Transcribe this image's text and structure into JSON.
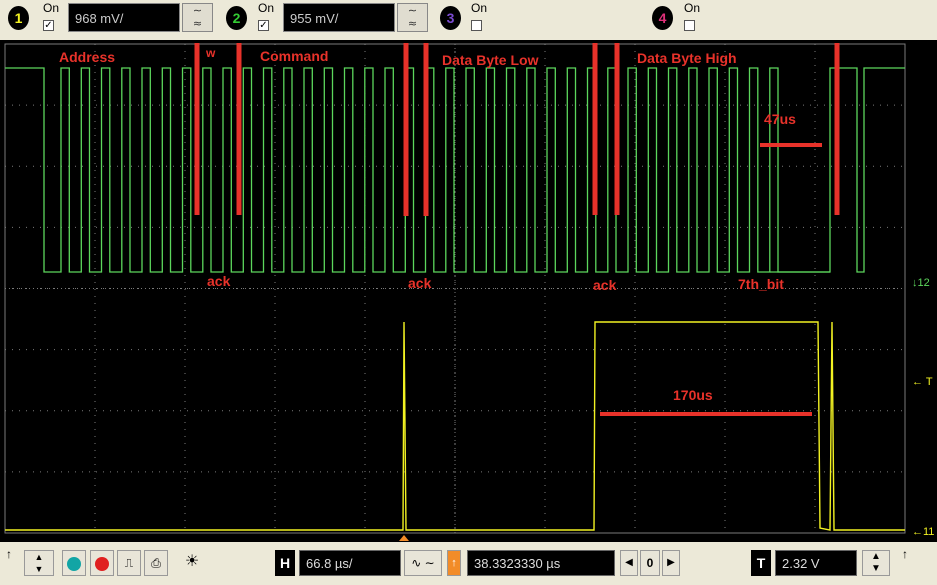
{
  "channels": [
    {
      "num": "1",
      "on_label": "On",
      "checked": true,
      "scale": "968 mV/",
      "color": "#f2f222"
    },
    {
      "num": "2",
      "on_label": "On",
      "checked": true,
      "scale": "955 mV/",
      "color": "#33cc33"
    },
    {
      "num": "3",
      "on_label": "On",
      "checked": false,
      "color": "#7a4bd0"
    },
    {
      "num": "4",
      "on_label": "On",
      "checked": false,
      "color": "#e0307a"
    }
  ],
  "annotations": {
    "address": "Address",
    "w": "w",
    "command": "Command",
    "data_low": "Data Byte Low",
    "data_high": "Data Byte High",
    "t47": "47us",
    "ack1": "ack",
    "ack2": "ack",
    "ack3": "ack",
    "seventh_bit": "7th_bit",
    "t170": "170us"
  },
  "side_markers": {
    "ch2": "12",
    "trig": "T",
    "ch1": "11"
  },
  "bottom": {
    "h_label": "H",
    "timebase": "66.8 µs/",
    "delay": "38.3323330 µs",
    "counter": "0",
    "t_label": "T",
    "trigger_level": "2.32 V"
  },
  "colors": {
    "ch1": "#f2f222",
    "ch2": "#5cd65c",
    "annotation": "#e8322a",
    "grid": "#7a7a7a"
  }
}
